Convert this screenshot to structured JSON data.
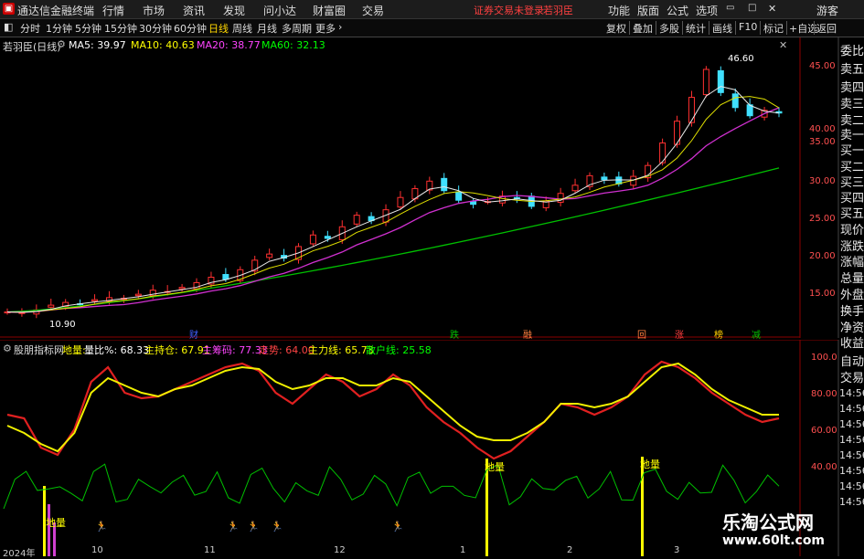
{
  "titlebar": {
    "app_name": "通达信金融终端",
    "menus": [
      "行情",
      "市场",
      "资讯",
      "发现",
      "问小达",
      "财富圈",
      "交易"
    ],
    "notice": "证券交易未登录",
    "user": "若羽臣",
    "right_menus": [
      "功能",
      "版面",
      "公式",
      "选项"
    ],
    "guest": "游客"
  },
  "toolbar": {
    "periods": [
      "分时",
      "1分钟",
      "5分钟",
      "15分钟",
      "30分钟",
      "60分钟",
      "日线",
      "周线",
      "月线",
      "多周期",
      "更多"
    ],
    "active": "日线",
    "right_items": [
      "复权",
      "叠加",
      "多股",
      "统计",
      "画线",
      "F10",
      "标记",
      "+自选",
      "返回"
    ]
  },
  "main": {
    "stock_label": "若羽臣(日线)",
    "ma": [
      {
        "label": "MA5: 39.97",
        "color": "#ffffff"
      },
      {
        "label": "MA10: 40.63",
        "color": "#ffff00"
      },
      {
        "label": "MA20: 38.77",
        "color": "#ff40ff"
      },
      {
        "label": "MA60: 32.13",
        "color": "#00ff00"
      }
    ],
    "price_axis": [
      "45.00",
      "40.00",
      "35.00",
      "30.00",
      "25.00",
      "20.00",
      "15.00"
    ],
    "high_label": "46.60",
    "low_label": "10.90",
    "events": [
      {
        "text": "财",
        "color": "#4060ff"
      },
      {
        "text": "跌",
        "color": "#00c000"
      },
      {
        "text": "融",
        "color": "#ff8040"
      },
      {
        "text": "回",
        "color": "#ff8040"
      },
      {
        "text": "涨",
        "color": "#ff4040"
      },
      {
        "text": "榜",
        "color": "#ffd000"
      },
      {
        "text": "减",
        "color": "#00c000"
      }
    ]
  },
  "right_panel": {
    "items": [
      "委比",
      "卖五",
      "卖四",
      "卖三",
      "卖二",
      "卖一",
      "买一",
      "买二",
      "买三",
      "买四",
      "买五",
      "现价",
      "涨跌",
      "涨幅",
      "总量",
      "外盘",
      "换手",
      "净资",
      "收益",
      "自动",
      "交易"
    ],
    "times": [
      "14:56",
      "14:56",
      "14:56",
      "14:56",
      "14:56",
      "14:56",
      "14:56",
      "14:56"
    ]
  },
  "indicator": {
    "name": "股朋指标网",
    "fields": [
      {
        "label": "地量:",
        "color": "#ffff00"
      },
      {
        "label": "量比%: 68.33",
        "color": "#ffffff"
      },
      {
        "label": "主持仓: 67.91",
        "color": "#ffff00"
      },
      {
        "label": "主筹码: 77.33",
        "color": "#ff40ff"
      },
      {
        "label": "走势: 64.00",
        "color": "#ff4040"
      },
      {
        "label": "主力线: 65.73",
        "color": "#ffff00"
      },
      {
        "label": "散户线: 25.58",
        "color": "#00ff00"
      }
    ],
    "axis": [
      "100.0",
      "80.00",
      "60.00",
      "40.00"
    ],
    "markers": [
      "地量",
      "地量",
      "地量"
    ]
  },
  "dates": [
    "2024年",
    "10",
    "11",
    "12",
    "1",
    "2",
    "3"
  ],
  "watermark": {
    "line1": "乐淘公式网",
    "line2": "www.60lt.com"
  },
  "chart_data": {
    "type": "line",
    "title": "",
    "candles_close": [
      11.0,
      10.9,
      11.3,
      12.0,
      12.4,
      12.2,
      12.8,
      13.1,
      13.0,
      13.6,
      14.2,
      14.0,
      14.6,
      15.3,
      16.1,
      15.8,
      17.2,
      18.6,
      19.5,
      18.9,
      20.6,
      22.3,
      21.8,
      23.5,
      25.2,
      24.4,
      26.0,
      27.8,
      29.1,
      30.2,
      28.8,
      27.4,
      26.8,
      27.2,
      28.0,
      27.6,
      26.5,
      27.3,
      28.4,
      29.6,
      31.0,
      30.4,
      29.8,
      30.9,
      32.5,
      35.8,
      39.0,
      42.5,
      46.6,
      43.2,
      41.0,
      39.8,
      40.6,
      40.2
    ],
    "ma60_range": [
      11.0,
      32.13
    ],
    "indicator_series": [
      {
        "name": "走势",
        "values": [
          66,
          64,
          48,
          44,
          58,
          84,
          92,
          78,
          75,
          76,
          80,
          84,
          88,
          92,
          94,
          90,
          78,
          72,
          80,
          88,
          84,
          76,
          80,
          88,
          82,
          70,
          62,
          56,
          48,
          42,
          46,
          54,
          62,
          72,
          70,
          66,
          70,
          76,
          88,
          95,
          92,
          86,
          78,
          72,
          66,
          62,
          64
        ]
      },
      {
        "name": "主力线",
        "values": [
          60,
          56,
          50,
          46,
          56,
          78,
          86,
          82,
          78,
          76,
          80,
          82,
          86,
          90,
          92,
          91,
          84,
          80,
          82,
          86,
          86,
          82,
          82,
          86,
          84,
          76,
          68,
          60,
          54,
          52,
          52,
          56,
          62,
          72,
          72,
          70,
          72,
          76,
          84,
          92,
          94,
          88,
          80,
          74,
          70,
          66,
          66
        ]
      }
    ]
  }
}
